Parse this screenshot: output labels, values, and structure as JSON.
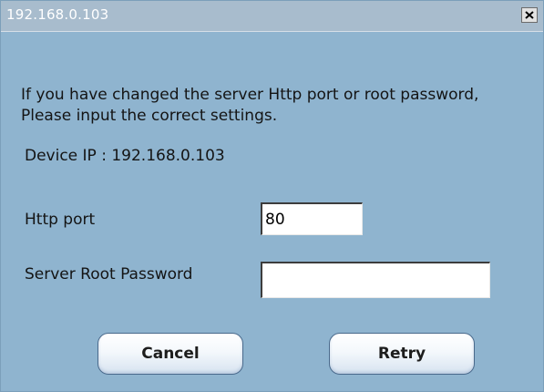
{
  "window": {
    "title": "192.168.0.103",
    "close_icon": "close-icon"
  },
  "message": "If you have changed the server Http port or root password, Please input the correct settings.",
  "device_ip_label": "Device IP : 192.168.0.103",
  "fields": {
    "http_port": {
      "label": "Http port",
      "value": "80"
    },
    "root_password": {
      "label": "Server Root Password",
      "value": ""
    }
  },
  "buttons": {
    "cancel": "Cancel",
    "retry": "Retry"
  },
  "colors": {
    "dialog_background": "#8fb4cf",
    "titlebar_background": "#a8bccd",
    "button_border": "#4a6a8c"
  }
}
